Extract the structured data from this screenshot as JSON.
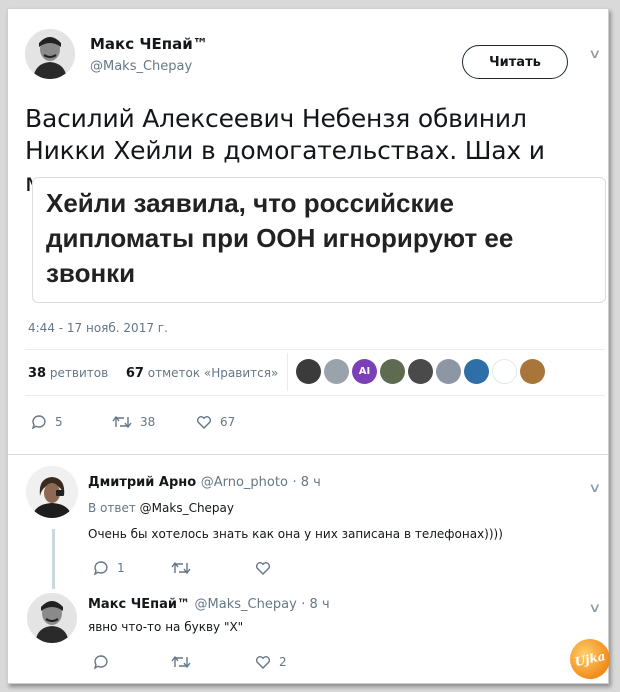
{
  "tweet": {
    "author_name": "Макс ЧЕпай™",
    "author_handle": "@Maks_Chepay",
    "follow_label": "Читать",
    "text": "Василий Алексеевич Небензя обвинил Никки Хейли в домогательствах. Шах и мат.",
    "card_headline": "Хейли заявила, что российские дипломаты при ООН игнорируют ее звонки",
    "timestamp": "4:44 - 17 нояб. 2017 г.",
    "retweets_count": "38",
    "retweets_label": "ретвитов",
    "likes_count": "67",
    "likes_label": "отметок «Нравится»",
    "likers": [
      "#3b3b3b",
      "#9aa3ab",
      "#7b3fb8",
      "#5e6b50",
      "#4a4a4a",
      "#8c97a3",
      "#2e6fa8",
      "#ffffff",
      "#a8753a"
    ],
    "liker_ai_label": "AI",
    "actions": {
      "replies": "5",
      "retweets": "38",
      "likes": "67"
    },
    "accent_color": "#1da1f2"
  },
  "replies": [
    {
      "author_name": "Дмитрий Арно",
      "author_handle": "@Arno_photo",
      "time": "· 8 ч",
      "reply_to_prefix": "В ответ",
      "reply_to_handle": "@Maks_Chepay",
      "text": "Очень бы хотелось знать как она у них записана в телефонах))))",
      "actions": {
        "replies": "1",
        "retweets": "",
        "likes": ""
      }
    },
    {
      "author_name": "Макс ЧЕпай™",
      "author_handle": "@Maks_Chepay",
      "time": "· 8 ч",
      "text": "явно что-то на букву \"Х\"",
      "actions": {
        "replies": "",
        "retweets": "",
        "likes": "2"
      }
    }
  ],
  "watermark": "Ujka"
}
